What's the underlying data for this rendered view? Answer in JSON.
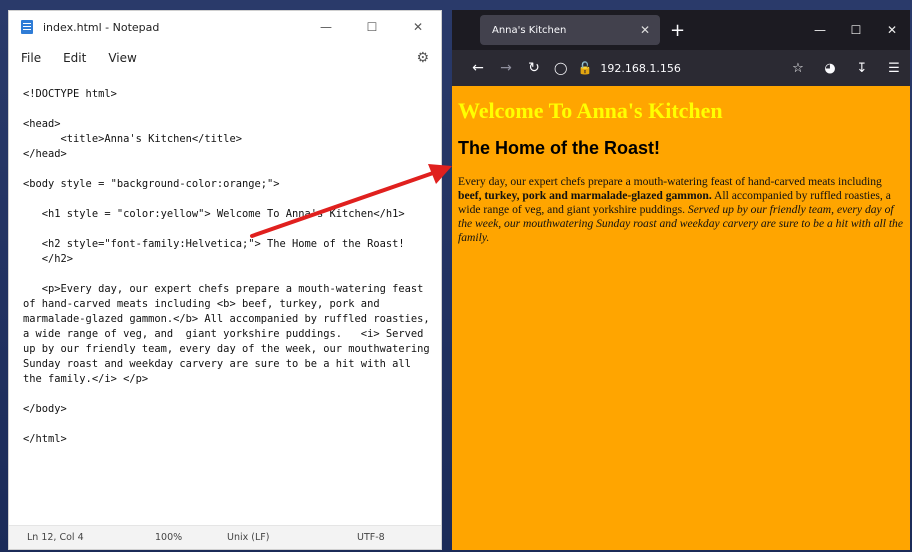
{
  "notepad": {
    "title": "index.html - Notepad",
    "menu": [
      "File",
      "Edit",
      "View"
    ],
    "code_lines": [
      "<!DOCTYPE html>",
      "",
      "<head>",
      "      <title>Anna's Kitchen</title>",
      "</head>",
      "",
      "<body style = \"background-color:orange;\">",
      "",
      "   <h1 style = \"color:yellow\"> Welcome To Anna's Kitchen</h1>",
      "",
      "   <h2 style=\"font-family:Helvetica;\"> The Home of the Roast!",
      "   </h2>",
      "",
      "   <p>Every day, our expert chefs prepare a mouth-watering feast",
      "of hand-carved meats including <b> beef, turkey, pork and",
      "marmalade-glazed gammon.</b> All accompanied by ruffled roasties,",
      "a wide range of veg, and  giant yorkshire puddings.   <i> Served",
      "up by our friendly team, every day of the week, our mouthwatering",
      "Sunday roast and weekday carvery are sure to be a hit with all",
      "the family.</i> </p>",
      "",
      "</body>",
      "",
      "</html>"
    ],
    "status": {
      "position": "Ln 12, Col 4",
      "zoom": "100%",
      "line_ending": "Unix (LF)",
      "encoding": "UTF-8"
    }
  },
  "browser": {
    "tab_title": "Anna's Kitchen",
    "url": "192.168.1.156",
    "page": {
      "h1": "Welcome To Anna's Kitchen",
      "h2": "The Home of the Roast!",
      "p_intro": "Every day, our expert chefs prepare a mouth-watering feast of hand-carved meats including ",
      "p_bold": "beef, turkey, pork and marmalade-glazed gammon.",
      "p_middle": " All accompanied by ruffled roasties, a wide range of veg, and giant yorkshire puddings. ",
      "p_italic": "Served up by our friendly team, every day of the week, our mouthwatering Sunday roast and weekday carvery are sure to be a hit with all the family."
    },
    "page_background": "#ffa500",
    "h1_color": "#ffff00"
  },
  "annotation": {
    "arrow_color": "#e0201e"
  }
}
